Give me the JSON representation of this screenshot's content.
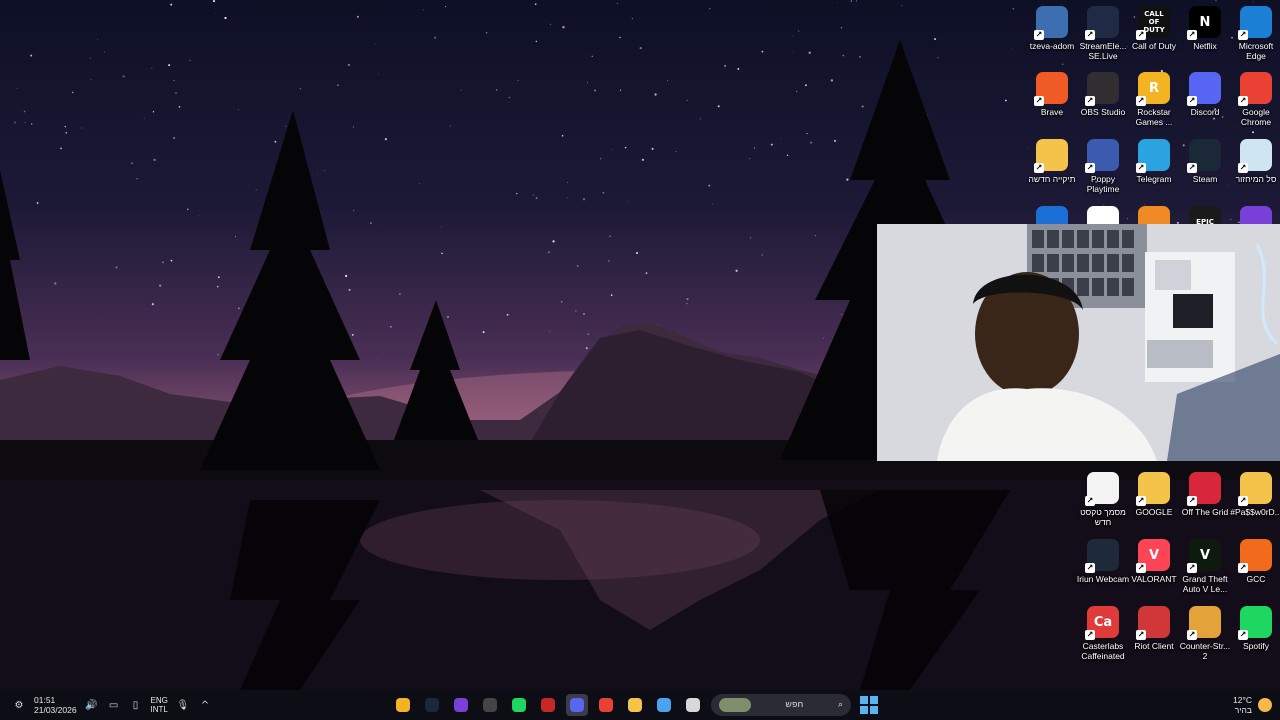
{
  "desktop_icons": [
    {
      "label": "tzeva-adom",
      "icon": "app-icon",
      "color": "#3d6fb0",
      "glyph": ""
    },
    {
      "label": "StreamEle... SE.Live",
      "icon": "astronaut-icon",
      "color": "#1f2b45",
      "glyph": ""
    },
    {
      "label": "Call of Duty",
      "icon": "call-of-duty-icon",
      "color": "#111111",
      "glyph": "CALL OF DUTY"
    },
    {
      "label": "Netflix",
      "icon": "netflix-icon",
      "color": "#000000",
      "glyph": "N"
    },
    {
      "label": "Microsoft Edge",
      "icon": "edge-icon",
      "color": "#1b7fd6",
      "glyph": ""
    },
    {
      "label": "Brave",
      "icon": "brave-icon",
      "color": "#f05a24",
      "glyph": ""
    },
    {
      "label": "OBS Studio",
      "icon": "obs-icon",
      "color": "#302e31",
      "glyph": ""
    },
    {
      "label": "Rockstar Games ...",
      "icon": "rockstar-icon",
      "color": "#f4b323",
      "glyph": "R"
    },
    {
      "label": "Discord",
      "icon": "discord-icon",
      "color": "#5865f2",
      "glyph": ""
    },
    {
      "label": "Google Chrome",
      "icon": "chrome-icon",
      "color": "#e94235",
      "glyph": ""
    },
    {
      "label": "תיקייה חדשה",
      "icon": "folder-icon",
      "color": "#f3c34a",
      "glyph": ""
    },
    {
      "label": "Poppy Playtime",
      "icon": "poppy-playtime-icon",
      "color": "#3b5bb0",
      "glyph": ""
    },
    {
      "label": "Telegram",
      "icon": "telegram-icon",
      "color": "#2aa3e0",
      "glyph": ""
    },
    {
      "label": "Steam",
      "icon": "steam-icon",
      "color": "#1b2838",
      "glyph": ""
    },
    {
      "label": "סל המיחזור",
      "icon": "recycle-bin-icon",
      "color": "#cfe6f2",
      "glyph": ""
    },
    {
      "label": "",
      "icon": "app-icon",
      "color": "#1d6fd8",
      "glyph": ""
    },
    {
      "label": "",
      "icon": "capcut-icon",
      "color": "#ffffff",
      "glyph": ""
    },
    {
      "label": "",
      "icon": "fruit-icon",
      "color": "#f08a24",
      "glyph": ""
    },
    {
      "label": "",
      "icon": "epic-games-icon",
      "color": "#1a1a1a",
      "glyph": "EPIC"
    },
    {
      "label": "",
      "icon": "app-icon",
      "color": "#7a3fd8",
      "glyph": ""
    },
    {
      "label": "מסמך טקסט חדש",
      "icon": "text-document-icon",
      "color": "#f4f4f4",
      "glyph": ""
    },
    {
      "label": "GOOGLE",
      "icon": "folder-icon",
      "color": "#f3c34a",
      "glyph": ""
    },
    {
      "label": "Off The Grid",
      "icon": "off-the-grid-icon",
      "color": "#d8263a",
      "glyph": ""
    },
    {
      "label": "#Pa$$w0rD...",
      "icon": "folder-icon",
      "color": "#f3c34a",
      "glyph": ""
    },
    {
      "label": "Iriun Webcam",
      "icon": "iriun-webcam-icon",
      "color": "#1e2a3a",
      "glyph": ""
    },
    {
      "label": "VALORANT",
      "icon": "valorant-icon",
      "color": "#fd4556",
      "glyph": "V"
    },
    {
      "label": "Grand Theft Auto V Le...",
      "icon": "gta-v-icon",
      "color": "#0f1a0f",
      "glyph": "V"
    },
    {
      "label": "GCC",
      "icon": "gcc-icon",
      "color": "#f26b1d",
      "glyph": ""
    },
    {
      "label": "Casterlabs Caffeinated",
      "icon": "casterlabs-icon",
      "color": "#e03a3a",
      "glyph": "Ca"
    },
    {
      "label": "Riot Client",
      "icon": "riot-client-icon",
      "color": "#d13639",
      "glyph": ""
    },
    {
      "label": "Counter-Str... 2",
      "icon": "counter-strike-icon",
      "color": "#e3a33a",
      "glyph": ""
    },
    {
      "label": "Spotify",
      "icon": "spotify-icon",
      "color": "#1ed760",
      "glyph": ""
    }
  ],
  "taskbar": {
    "time": "01:51",
    "date": "21/03/2026",
    "lang_top": "ENG",
    "lang_bottom": "INTL",
    "search_placeholder": "חפש",
    "weather_temp": "12°C",
    "weather_desc": "בהיר",
    "apps": [
      {
        "icon": "rockstar-icon",
        "color": "#f4b323",
        "active": false
      },
      {
        "icon": "steam-icon",
        "color": "#1b2838",
        "active": false
      },
      {
        "icon": "app-icon",
        "color": "#7a3fd8",
        "active": false
      },
      {
        "icon": "clock-icon",
        "color": "#444444",
        "active": false
      },
      {
        "icon": "spotify-icon",
        "color": "#1ed760",
        "active": false
      },
      {
        "icon": "app-icon",
        "color": "#c62828",
        "active": false
      },
      {
        "icon": "discord-icon",
        "color": "#5865f2",
        "active": true
      },
      {
        "icon": "chrome-icon",
        "color": "#e94235",
        "active": false
      },
      {
        "icon": "file-explorer-icon",
        "color": "#f3c34a",
        "active": false
      },
      {
        "icon": "apps-grid-icon",
        "color": "#4aa3f0",
        "active": false
      },
      {
        "icon": "task-view-icon",
        "color": "#d8d8d8",
        "active": false
      }
    ]
  }
}
